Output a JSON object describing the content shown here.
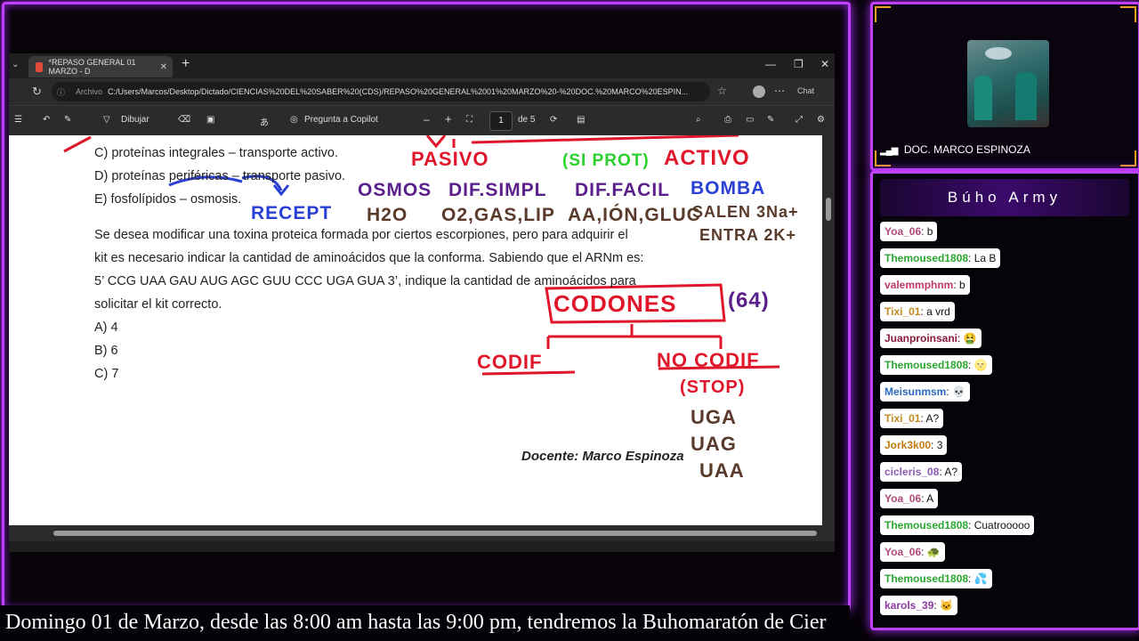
{
  "browser": {
    "tab_title": "*REPASO GENERAL 01 MARZO - D",
    "address_label": "Archivo",
    "url": "C:/Users/Marcos/Desktop/Dictado/CIENCIAS%20DEL%20SABER%20(CDS)/REPASO%20GENERAL%2001%20MARZO%20-%20DOC.%20MARCO%20ESPIN...",
    "chat_button": "Chat"
  },
  "pdf_toolbar": {
    "draw_label": "Dibujar",
    "copilot_label": "Pregunta a Copilot",
    "page_current": "1",
    "page_total": "de 5",
    "minus": "–",
    "plus": "+"
  },
  "document": {
    "option_c1": "C) proteínas integrales – transporte activo.",
    "option_d1": "D) proteínas periféricas – transporte pasivo.",
    "option_e1": "E) fosfolípidos – osmosis.",
    "question_lines": [
      "Se desea modificar una toxina proteica formada por ciertos escorpiones, pero para adquirir el",
      "kit es necesario indicar la cantidad de aminoácidos que la conforma. Sabiendo que el ARNm es:",
      "5’ CCG UAA GAU AUG AGC GUU CCC UGA GUA 3’, indique la cantidad de aminoácidos para",
      "solicitar el kit correcto."
    ],
    "answers": [
      "A) 4",
      "B) 6",
      "C) 7"
    ],
    "footer": "Docente: Marco Espinoza"
  },
  "annotations": {
    "pasivo": "PASIVO",
    "siprot": "(SI PROT)",
    "activo": "ACTIVO",
    "osmos": "OSMOS",
    "difsimpl": "DIF.SIMPL",
    "diffacil": "DIF.FACIL",
    "bomba": "BOMBA",
    "h2o": "H2O",
    "o2": "O2,GAS,LIP",
    "ion": "AA,IÓN,GLUC",
    "sale": "SALEN 3Na+",
    "entra": "ENTRA 2K+",
    "recept": "RECEPT",
    "codones": "CODONES",
    "codones_count": "(64)",
    "codif": "CODIF",
    "nocodif": "NO CODIF",
    "stop": "(STOP)",
    "uga": "UGA",
    "uag": "UAG",
    "uaa": "UAA"
  },
  "webcam": {
    "name": "DOC. MARCO ESPINOZA"
  },
  "chat": {
    "title": "Búho Army",
    "messages": [
      {
        "user": "Yoa_06",
        "text": ": b",
        "color": "#b04a7a"
      },
      {
        "user": "Themoused1808",
        "text": ": La B",
        "color": "#2aa830"
      },
      {
        "user": "valemmphnm",
        "text": ": b",
        "color": "#c03a6a"
      },
      {
        "user": "Tixi_01",
        "text": ": a vrd",
        "color": "#c08a20"
      },
      {
        "user": "Juanproinsani",
        "text": ": 🤮",
        "color": "#8a1a3a"
      },
      {
        "user": "Themoused1808",
        "text": ": 🌝",
        "color": "#2aa830"
      },
      {
        "user": "Meisunmsm",
        "text": ": 💀",
        "color": "#2a6ac0"
      },
      {
        "user": "Tixi_01",
        "text": ": A?",
        "color": "#c08a20"
      },
      {
        "user": "Jork3k00",
        "text": ": 3",
        "color": "#c07a10"
      },
      {
        "user": "cicleris_08",
        "text": ": A?",
        "color": "#8a5ab0"
      },
      {
        "user": "Yoa_06",
        "text": ": A",
        "color": "#b04a7a"
      },
      {
        "user": "Themoused1808",
        "text": ": Cuatrooooo",
        "color": "#2aa830"
      },
      {
        "user": "Yoa_06",
        "text": ": 🐢",
        "color": "#b04a7a"
      },
      {
        "user": "Themoused1808",
        "text": ": 💦",
        "color": "#2aa830"
      },
      {
        "user": "karols_39",
        "text": ": 🐱",
        "color": "#8a3aa0"
      }
    ]
  },
  "ticker": {
    "text": "Domingo 01 de Marzo, desde las 8:00 am hasta las 9:00 pm, tendremos la Buhomaratón de Cier"
  },
  "colors": {
    "frame_glow": "#c040ff",
    "ink_red": "#e0162b",
    "ink_blue": "#2a3fd4",
    "ink_green": "#2bd12b",
    "ink_brown": "#5a3a2a",
    "ink_purple": "#5a1f8a",
    "corner_accent": "#f1a020"
  }
}
